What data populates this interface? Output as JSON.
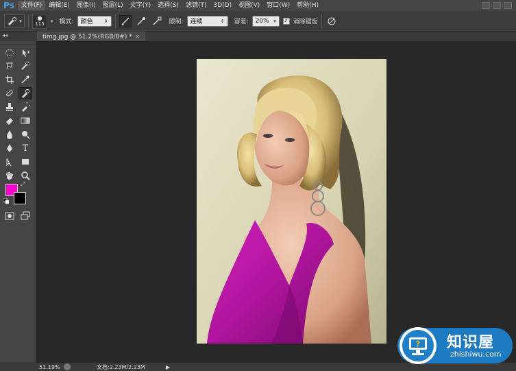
{
  "app": {
    "logo": "Ps"
  },
  "menu": {
    "items": [
      "文件(F)",
      "编辑(E)",
      "图像(I)",
      "图层(L)",
      "文字(Y)",
      "选择(S)",
      "滤镜(T)",
      "3D(D)",
      "视图(V)",
      "窗口(W)",
      "帮助(H)"
    ]
  },
  "options": {
    "brush_size": "115",
    "mode_label": "模式:",
    "mode_value": "颜色",
    "limits_label": "限制:",
    "limits_value": "连续",
    "tolerance_label": "容差:",
    "tolerance_value": "20%",
    "antialias_label": "消除锯齿",
    "antialias_checked": true
  },
  "document": {
    "tab_title": "timg.jpg @ 51.2%(RGB/8#) *",
    "tab_close": "×"
  },
  "colors": {
    "foreground": "#ff00cc",
    "background": "#000000"
  },
  "status": {
    "zoom": "51.19%",
    "doc_info": "文档:2.23M/2.23M"
  },
  "watermark": {
    "title": "知识屋",
    "url": "zhishiwu.com"
  }
}
